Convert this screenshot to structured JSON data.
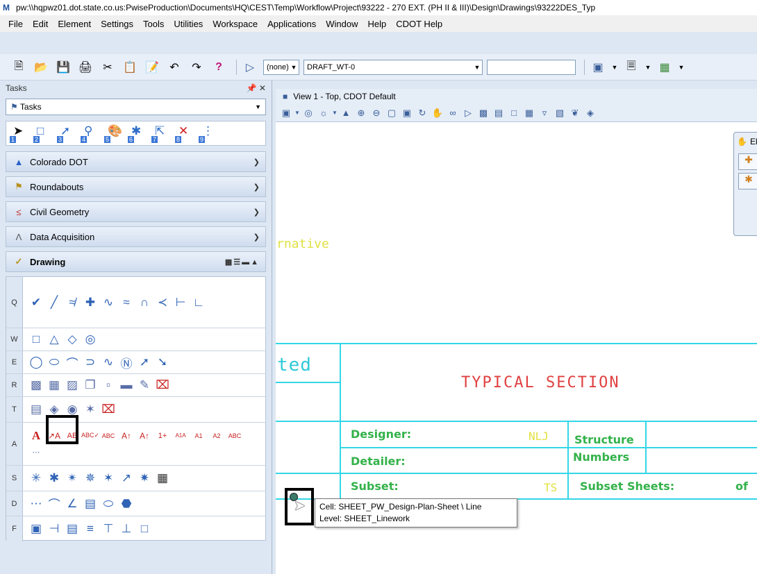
{
  "window": {
    "title": "pw:\\\\hqpwz01.dot.state.co.us:PwiseProduction\\Documents\\HQ\\CEST\\Temp\\Workflow\\Project\\93222 - 270 EXT. (PH II & III)\\Design\\Drawings\\93222DES_Typ"
  },
  "menu": {
    "items": [
      "File",
      "Edit",
      "Element",
      "Settings",
      "Tools",
      "Utilities",
      "Workspace",
      "Applications",
      "Window",
      "Help",
      "CDOT Help"
    ]
  },
  "toolbar": {
    "level_combo": "(none)",
    "style_combo": "DRAFT_WT-0",
    "help_glyph": "?"
  },
  "tasks": {
    "title": "Tasks",
    "combo_value": "Tasks",
    "number_tools": [
      "1",
      "2",
      "3",
      "4",
      "5",
      "6",
      "7",
      "8",
      "9"
    ],
    "sections": [
      {
        "label": "Colorado DOT",
        "icon": "colorado-icon"
      },
      {
        "label": "Roundabouts",
        "icon": "roundabout-icon"
      },
      {
        "label": "Civil Geometry",
        "icon": "geometry-icon"
      },
      {
        "label": "Data Acquisition",
        "icon": "survey-icon"
      }
    ],
    "drawing": {
      "label": "Drawing",
      "rows": [
        {
          "key": "Q"
        },
        {
          "key": "W"
        },
        {
          "key": "E"
        },
        {
          "key": "R"
        },
        {
          "key": "T"
        },
        {
          "key": "A"
        },
        {
          "key": "S"
        },
        {
          "key": "D"
        },
        {
          "key": "F"
        }
      ]
    }
  },
  "view": {
    "title": "View 1 - Top, CDOT Default",
    "floating_dialog_label": "Ele"
  },
  "drawing_sheet": {
    "fragment_alt": "rnative",
    "fragment_ted": "ted",
    "title": "TYPICAL SECTION",
    "designer_label": "Designer:",
    "designer_value": "NLJ",
    "detailer_label": "Detailer:",
    "subset_label": "Subset:",
    "subset_value": "TS",
    "structure_label": "Structure",
    "numbers_label": "Numbers",
    "subset_sheets_label": "Subset Sheets:",
    "of_label": "of"
  },
  "tooltip": {
    "line1": "Cell: SHEET_PW_Design-Plan-Sheet \\ Line",
    "line2": "Level: SHEET_Linework"
  }
}
